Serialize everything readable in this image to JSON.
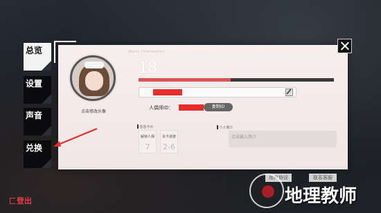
{
  "tabs": [
    {
      "label": "总览",
      "active": true
    },
    {
      "label": "设置",
      "active": false
    },
    {
      "label": "声音",
      "active": false
    },
    {
      "label": "兑换",
      "active": false
    }
  ],
  "logout_label": "登出",
  "profile": {
    "avatar_caption": "点击修改头像",
    "section_eng": "Basic Information",
    "level": "18",
    "exp_progress": 0.47,
    "puppeteer_id_label": "人偶师ID：",
    "copy_id_label": "复制ID",
    "card_section_label": "信息卡片",
    "cards": [
      {
        "title": "解锁人偶",
        "value": "7"
      },
      {
        "title": "关卡进度",
        "value": "2-6"
      }
    ],
    "intro_section_label": "个人简介",
    "intro_placeholder": "点击输入简介"
  },
  "footer": {
    "user_agreement": "用户协议",
    "contact_support": "联系客服"
  },
  "watermark_text": "地理教师",
  "colors": {
    "accent_red": "#e62e2e",
    "panel_bg": "#f4eaea"
  }
}
